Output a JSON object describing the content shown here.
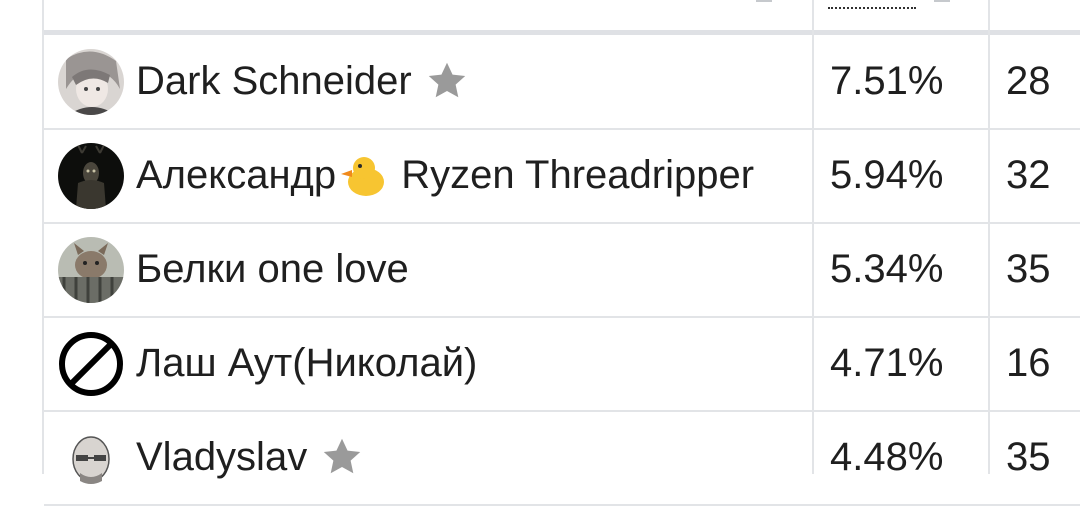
{
  "rows": [
    {
      "name": "Dark Schneider",
      "pct": "7.51%",
      "third": "28",
      "favorite": true,
      "avatar": "anime-avatar"
    },
    {
      "name_before": "Александр",
      "emoji": "duck",
      "name_after": " Ryzen Threadripper",
      "pct": "5.94%",
      "third": "32",
      "favorite": false,
      "avatar": "deer-avatar"
    },
    {
      "name": "Белки one love",
      "pct": "5.34%",
      "third": "35",
      "favorite": false,
      "avatar": "squirrel-avatar"
    },
    {
      "name": "Лаш Аут(Николай)",
      "pct": "4.71%",
      "third": "16",
      "favorite": false,
      "avatar": "prohibited-avatar"
    },
    {
      "name": "Vladyslav",
      "pct": "4.48%",
      "third": "35",
      "favorite": true,
      "avatar": "bald-man-avatar"
    }
  ],
  "colors": {
    "star": "#9a9a9a",
    "grid": "#e2e4e7",
    "text": "#1f1f1f"
  }
}
